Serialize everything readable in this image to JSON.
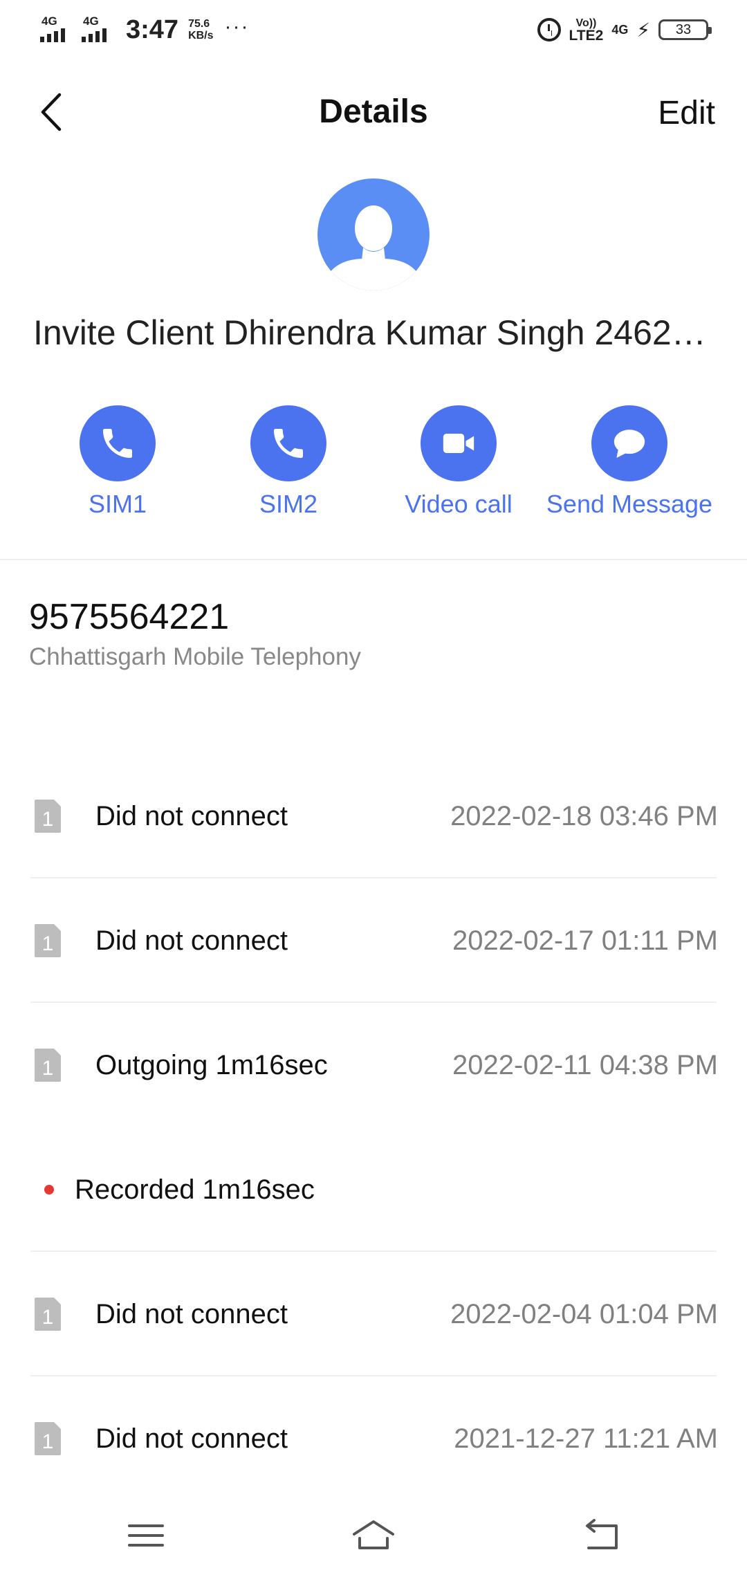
{
  "status_bar": {
    "sim1_network": "4G",
    "sim2_network": "4G",
    "time": "3:47",
    "speed_value": "75.6",
    "speed_unit": "KB/s",
    "more": "···",
    "volte": "Vo))",
    "lte": "LTE2",
    "data_network": "4G",
    "battery": "33"
  },
  "header": {
    "title": "Details",
    "edit_label": "Edit"
  },
  "contact": {
    "name": "Invite Client Dhirendra Kumar Singh 2462…",
    "number": "9575564221",
    "carrier": "Chhattisgarh Mobile Telephony"
  },
  "actions": [
    {
      "label": "SIM1",
      "icon": "phone-icon"
    },
    {
      "label": "SIM2",
      "icon": "phone-icon"
    },
    {
      "label": "Video call",
      "icon": "video-camera-icon"
    },
    {
      "label": "Send Message",
      "icon": "chat-bubble-icon"
    }
  ],
  "call_log": [
    {
      "sim": "1",
      "description": "Did not connect",
      "time": "2022-02-18 03:46 PM"
    },
    {
      "sim": "1",
      "description": "Did not connect",
      "time": "2022-02-17 01:11 PM"
    },
    {
      "sim": "1",
      "description": "Outgoing 1m16sec",
      "time": "2022-02-11 04:38 PM"
    },
    {
      "description": "Recorded 1m16sec"
    },
    {
      "sim": "1",
      "description": "Did not connect",
      "time": "2022-02-04 01:04 PM"
    },
    {
      "sim": "1",
      "description": "Did not connect",
      "time": "2021-12-27 11:21 AM"
    }
  ],
  "colors": {
    "accent": "#4b72ef",
    "avatar": "#5a8ef5",
    "recording_dot": "#e53935",
    "secondary_text": "#808080"
  }
}
